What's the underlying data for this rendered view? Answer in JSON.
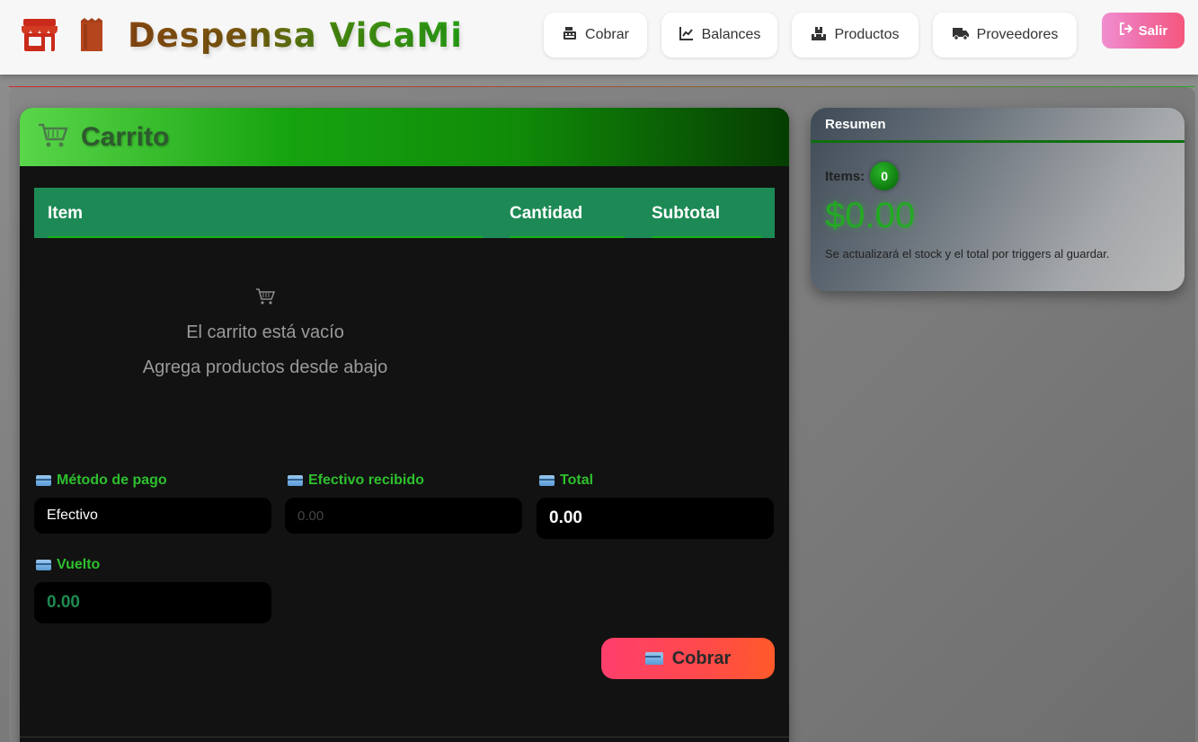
{
  "brand": {
    "title": "Despensa ViCaMi"
  },
  "nav": {
    "cobrar": "Cobrar",
    "balances": "Balances",
    "productos": "Productos",
    "proveedores": "Proveedores",
    "salir": "Salir"
  },
  "cart": {
    "title": "Carrito",
    "columns": {
      "item": "Item",
      "cantidad": "Cantidad",
      "subtotal": "Subtotal"
    },
    "empty_line1": "El carrito está vacío",
    "empty_line2": "Agrega productos desde abajo"
  },
  "form": {
    "metodo_label": "Método de pago",
    "metodo_value": "Efectivo",
    "efectivo_label": "Efectivo recibido",
    "efectivo_placeholder": "0.00",
    "total_label": "Total",
    "total_value": "0.00",
    "vuelto_label": "Vuelto",
    "vuelto_value": "0.00",
    "cobrar_button": "Cobrar"
  },
  "summary": {
    "title": "Resumen",
    "items_label": "Items:",
    "items_count": "0",
    "total": "$0.00",
    "note": "Se actualizará el stock y el total por triggers al guardar."
  },
  "colors": {
    "accent_green": "#2ec02e",
    "header_bg": "#f7f7f7",
    "cobrar_gradient_start": "#ff3f6c",
    "cobrar_gradient_end": "#ff5a2a"
  }
}
